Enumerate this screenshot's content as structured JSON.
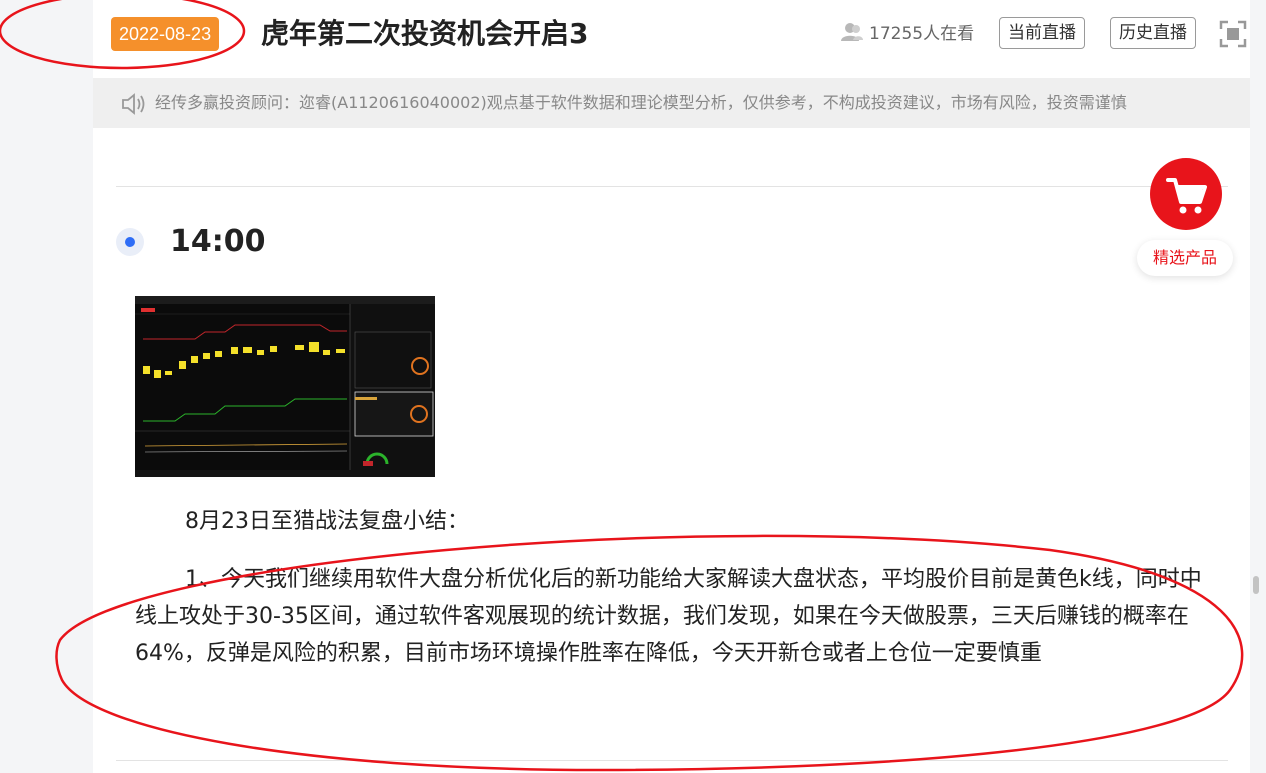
{
  "header": {
    "date": "2022-08-23",
    "title": "虎年第二次投资机会开启3",
    "viewers": "17255人在看",
    "current_live_label": "当前直播",
    "history_live_label": "历史直播"
  },
  "notice": {
    "text": "经传多赢投资顾问：迩睿(A1120616040002)观点基于软件数据和理论模型分析，仅供参考，不构成投资建议，市场有风险，投资需谨慎"
  },
  "post": {
    "time": "14:00",
    "summary_title": "8月23日至猎战法复盘小结：",
    "point_1": "1、今天我们继续用软件大盘分析优化后的新功能给大家解读大盘状态，平均股价目前是黄色k线，同时中线上攻处于30-35区间，通过软件客观展现的统计数据，我们发现，如果在今天做股票，三天后赚钱的概率在64%，反弹是风险的积累，目前市场环境操作胜率在降低，今天开新仓或者上仓位一定要慎重"
  },
  "floating_cart": {
    "label": "精选产品"
  },
  "colors": {
    "date_badge": "#f5902b",
    "timeline_dot": "#2e6df6",
    "cart": "#e8141b",
    "annotation": "#e8141b"
  },
  "icons": [
    "user-icon",
    "fullscreen-icon",
    "speaker-icon",
    "cart-icon"
  ]
}
